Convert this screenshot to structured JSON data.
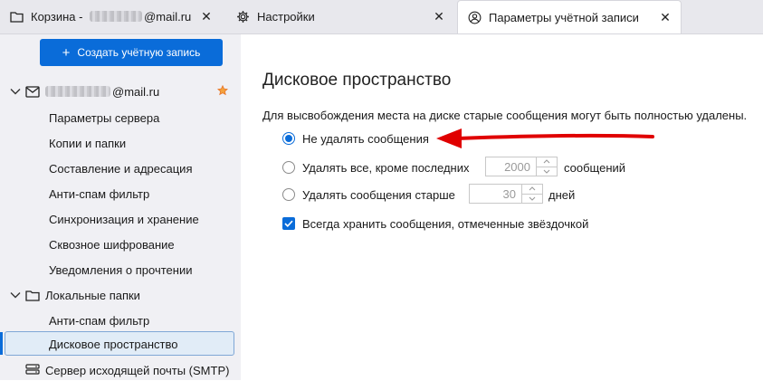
{
  "tabs": [
    {
      "prefix": "Корзина - ",
      "suffix": "@mail.ru",
      "active": false
    },
    {
      "label": "Настройки",
      "active": false
    },
    {
      "label": "Параметры учётной записи",
      "active": true
    }
  ],
  "sidebar": {
    "create_button": "Создать учётную запись",
    "account": {
      "email_suffix": "@mail.ru"
    },
    "account_items": [
      "Параметры сервера",
      "Копии и папки",
      "Составление и адресация",
      "Анти-спам фильтр",
      "Синхронизация и хранение",
      "Сквозное шифрование",
      "Уведомления о прочтении"
    ],
    "local_folders": "Локальные папки",
    "local_items": [
      "Анти-спам фильтр",
      "Дисковое пространство"
    ],
    "smtp": "Сервер исходящей почты (SMTP)"
  },
  "main": {
    "title": "Дисковое пространство",
    "description": "Для высвобождения места на диске старые сообщения могут быть полностью удалены.",
    "opt_keep_all": "Не удалять сообщения",
    "opt_keep_recent": "Удалять все, кроме последних",
    "recent_value": "2000",
    "recent_suffix": "сообщений",
    "opt_older": "Удалять сообщения старше",
    "older_value": "30",
    "older_suffix": "дней",
    "keep_starred": "Всегда хранить сообщения, отмеченные звёздочкой"
  },
  "colors": {
    "accent": "#0a6cd9",
    "arrow": "#e00000",
    "star": "#e8762b"
  }
}
